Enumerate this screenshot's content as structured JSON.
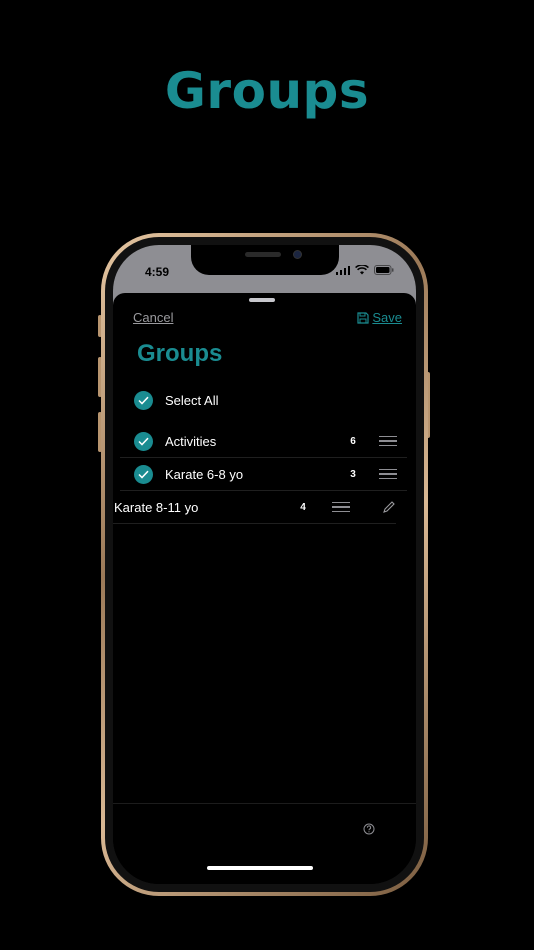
{
  "headline": "Groups",
  "status_bar": {
    "time": "4:59"
  },
  "sheet": {
    "cancel_label": "Cancel",
    "save_label": "Save",
    "title": "Groups",
    "select_all_label": "Select All"
  },
  "groups": [
    {
      "name": "Activities",
      "count": "6",
      "selected": true
    },
    {
      "name": "Karate 6-8 yo",
      "count": "3",
      "selected": true
    },
    {
      "name": "Karate 8-11 yo",
      "count": "4",
      "selected": false
    }
  ],
  "colors": {
    "accent": "#1a8c91",
    "background": "#000000",
    "frame": "#c9a27c"
  },
  "icons": [
    "checkmark-icon",
    "save-icon",
    "drag-handle-icon",
    "edit-pencil-icon",
    "help-icon",
    "wifi-icon",
    "battery-icon",
    "signal-icon"
  ]
}
